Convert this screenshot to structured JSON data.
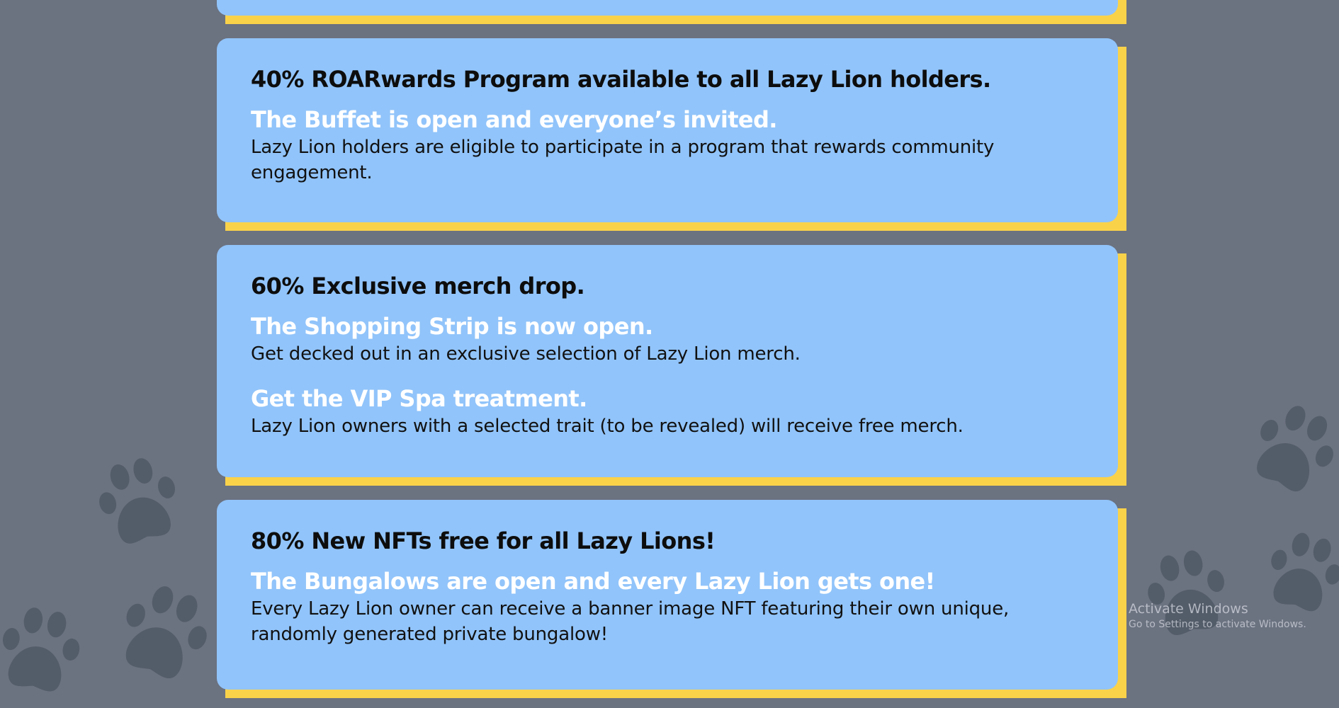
{
  "colors": {
    "background": "#6b7280",
    "card": "#91c4fa",
    "card_shadow": "#fad24a",
    "milestone_text": "#0d0d0d",
    "perk_title_text": "#ffffff",
    "paw_print": "#535c69"
  },
  "background_icon": "paw-print-icon",
  "roadmap": {
    "cards": [
      {
        "milestone": "40% ROARwards Program available to all Lazy Lion holders.",
        "perks": [
          {
            "title": "The Buffet is open and everyone’s invited.",
            "description": "Lazy Lion holders are eligible to participate in a program that rewards community engagement."
          }
        ]
      },
      {
        "milestone": "60% Exclusive merch drop.",
        "perks": [
          {
            "title": "The Shopping Strip is now open.",
            "description": "Get decked out in an exclusive selection of Lazy Lion merch."
          },
          {
            "title": "Get the VIP Spa treatment.",
            "description": "Lazy Lion owners with a selected trait (to be revealed) will receive free merch."
          }
        ]
      },
      {
        "milestone": "80% New NFTs free for all Lazy Lions!",
        "perks": [
          {
            "title": "The Bungalows are open and every Lazy Lion gets one!",
            "description": "Every Lazy Lion owner can receive a banner image NFT featuring their own unique, randomly generated private bungalow!"
          }
        ]
      }
    ]
  },
  "os_watermark": {
    "title": "Activate Windows",
    "subtitle": "Go to Settings to activate Windows."
  }
}
